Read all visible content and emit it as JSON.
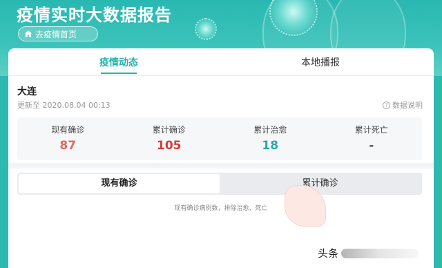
{
  "header": {
    "title": "疫情实时大数据报告",
    "home_button": "去疫情首页"
  },
  "tabs": [
    {
      "label": "疫情动态",
      "active": true
    },
    {
      "label": "本地播报",
      "active": false
    }
  ],
  "location": {
    "city": "大连",
    "updated": "更新至 2020.08.04 00:13",
    "explain_link": "数据说明"
  },
  "stats": [
    {
      "label": "现有确诊",
      "value": "87",
      "color": "#e8665c"
    },
    {
      "label": "累计确诊",
      "value": "105",
      "color": "#d43c36"
    },
    {
      "label": "累计治愈",
      "value": "18",
      "color": "#28a8a8"
    },
    {
      "label": "累计死亡",
      "value": "-",
      "color": "#555555"
    }
  ],
  "segmented": [
    {
      "label": "现有确诊",
      "active": true
    },
    {
      "label": "累计确诊",
      "active": false
    }
  ],
  "map_note": "现有确诊病例数，排除治愈、死亡",
  "watermark": "头条",
  "colors": {
    "accent": "#23b3ae",
    "header_bg": "#2cb9b0"
  },
  "icons": {
    "home": "house-icon",
    "help": "question-circle-icon"
  }
}
